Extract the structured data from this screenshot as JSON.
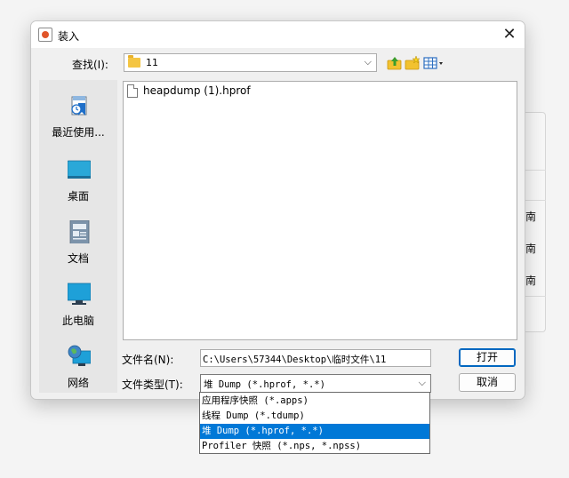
{
  "dialog": {
    "title": "装入",
    "close_glyph": "✕"
  },
  "lookin": {
    "label": "查找(I):",
    "value": "11",
    "arrow": "⌵"
  },
  "toolbar": {
    "icons": [
      "up-folder-icon",
      "new-folder-icon",
      "view-menu-icon"
    ]
  },
  "places": [
    {
      "label": "最近使用...",
      "icon": "recent-icon"
    },
    {
      "label": "桌面",
      "icon": "desktop-icon"
    },
    {
      "label": "文档",
      "icon": "documents-icon"
    },
    {
      "label": "此电脑",
      "icon": "computer-icon"
    },
    {
      "label": "网络",
      "icon": "network-icon"
    }
  ],
  "files": [
    {
      "name": "heapdump (1).hprof",
      "icon": "file-icon"
    }
  ],
  "filename": {
    "label": "文件名(N):",
    "value": "C:\\Users\\57344\\Desktop\\临时文件\\11"
  },
  "filetype": {
    "label": "文件类型(T):",
    "value": "堆 Dump (*.hprof, *.*)",
    "arrow": "⌵",
    "options": [
      "应用程序快照 (*.apps)",
      "线程 Dump (*.tdump)",
      "堆 Dump (*.hprof, *.*)",
      "Profiler 快照 (*.nps, *.npss)"
    ],
    "selected_index": 2
  },
  "buttons": {
    "open": "打开",
    "cancel": "取消"
  },
  "background_window": {
    "glyphs": [
      "南",
      "南",
      "南"
    ]
  },
  "colors": {
    "accent": "#0078d7",
    "selection_text": "#ffffff"
  }
}
